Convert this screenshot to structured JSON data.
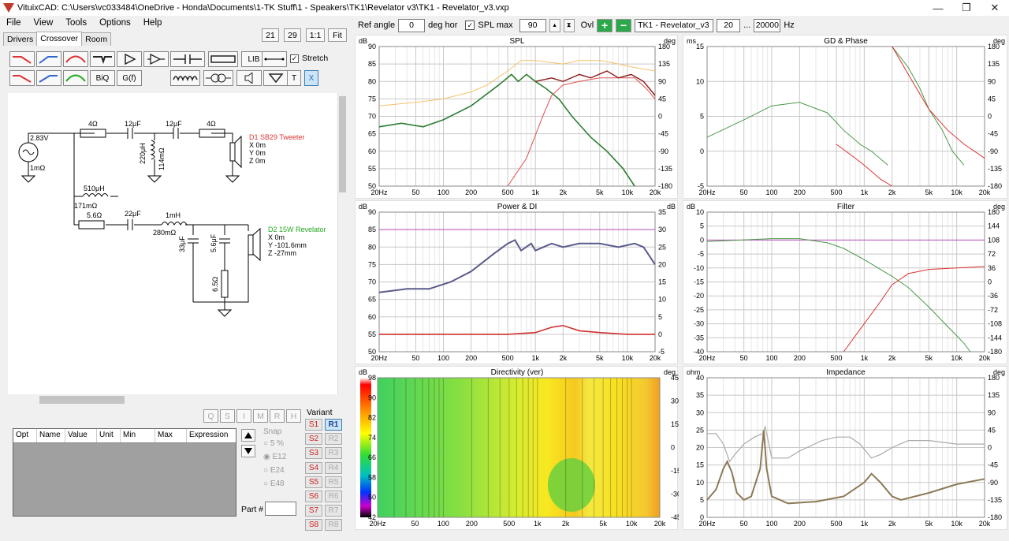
{
  "window": {
    "title": "VituixCAD: C:\\Users\\vc033484\\OneDrive - Honda\\Documents\\1-TK Stuff\\1 - Speakers\\TK1\\Revelator v3\\TK1 - Revelator_v3.vxp",
    "min": "—",
    "max": "❐",
    "close": "✕"
  },
  "menu": [
    "File",
    "View",
    "Tools",
    "Options",
    "Help"
  ],
  "tabs": [
    "Drivers",
    "Crossover",
    "Room"
  ],
  "zoom_buttons": [
    "21",
    "29",
    "1:1",
    "Fit"
  ],
  "toolbar": {
    "lib": "LIB",
    "biq": "BiQ",
    "gf": "G(f)",
    "stretch": "Stretch",
    "t": "T",
    "x": "X"
  },
  "top": {
    "ref_angle_label": "Ref angle",
    "ref_angle": "0",
    "deg_hor": "deg hor",
    "spl_max_label": "SPL max",
    "spl_max": "90",
    "ovl": "Ovl",
    "variant_name": "TK1 - Revelator_v3",
    "f_lo": "20",
    "dots": "...",
    "f_hi": "20000",
    "hz": "Hz"
  },
  "schematic": {
    "source": "2.83V",
    "source_r": "1mΩ",
    "r1": "4Ω",
    "c1": "12μF",
    "c2": "12μF",
    "r2": "4Ω",
    "l1": "220μH",
    "l1r": "114mΩ",
    "d1_name": "D1 SB29 Tweeter",
    "d1_x": "X 0m",
    "d1_y": "Y 0m",
    "d1_z": "Z 0m",
    "l2": "510μH",
    "l2r": "171mΩ",
    "r3": "5.6Ω",
    "c3": "22μF",
    "l3": "1mH",
    "l3r": "280mΩ",
    "c4": "33μF",
    "c5": "5.6μF",
    "r4": "6.5Ω",
    "d2_name": "D2 15W Revelator",
    "d2_x": "X 0m",
    "d2_y": "Y -101.6mm",
    "d2_z": "Z -27mm"
  },
  "param_buttons": [
    "Q",
    "S",
    "I",
    "M",
    "R",
    "H"
  ],
  "table_headers": [
    "Opt",
    "Name",
    "Value",
    "Unit",
    "Min",
    "Max",
    "Expression"
  ],
  "snap": {
    "label": "Snap",
    "options": [
      "5 %",
      "E12",
      "E24",
      "E48"
    ]
  },
  "part_label": "Part #",
  "variant": {
    "label": "Variant",
    "s": [
      "S1",
      "S2",
      "S3",
      "S4",
      "S5",
      "S6",
      "S7",
      "S8"
    ],
    "r": [
      "R1",
      "R2",
      "R3",
      "R4",
      "R5",
      "R6",
      "R7",
      "R8"
    ]
  },
  "charts": {
    "spl": {
      "title": "SPL",
      "lu": "dB",
      "ru": "deg",
      "left": [
        "90",
        "85",
        "80",
        "75",
        "70",
        "65",
        "60",
        "55",
        "50"
      ],
      "right": [
        "180",
        "135",
        "90",
        "45",
        "0",
        "-45",
        "-90",
        "-135",
        "-180"
      ],
      "x": [
        "20Hz",
        "50",
        "100",
        "200",
        "500",
        "1k",
        "2k",
        "5k",
        "10k",
        "20k"
      ]
    },
    "gd": {
      "title": "GD & Phase",
      "lu": "ms",
      "ru": "deg",
      "left": [
        "15",
        "10",
        "5",
        "0",
        "-5"
      ],
      "right": [
        "180",
        "135",
        "90",
        "45",
        "0",
        "-45",
        "-90",
        "-135",
        "-180"
      ],
      "x": [
        "20Hz",
        "50",
        "100",
        "200",
        "500",
        "1k",
        "2k",
        "5k",
        "10k",
        "20k"
      ]
    },
    "power": {
      "title": "Power & DI",
      "lu": "dB",
      "ru": "dB",
      "left": [
        "90",
        "85",
        "80",
        "75",
        "70",
        "65",
        "60",
        "55",
        "50"
      ],
      "right": [
        "35",
        "30",
        "25",
        "20",
        "15",
        "10",
        "5",
        "0",
        "-5"
      ],
      "x": [
        "20Hz",
        "50",
        "100",
        "200",
        "500",
        "1k",
        "2k",
        "5k",
        "10k",
        "20k"
      ]
    },
    "filter": {
      "title": "Filter",
      "lu": "dB",
      "ru": "deg",
      "left": [
        "10",
        "5",
        "0",
        "-5",
        "-10",
        "-15",
        "-20",
        "-25",
        "-30",
        "-35",
        "-40"
      ],
      "right": [
        "180",
        "144",
        "108",
        "72",
        "36",
        "0",
        "-36",
        "-72",
        "-108",
        "-144",
        "-180"
      ],
      "x": [
        "20Hz",
        "50",
        "100",
        "200",
        "500",
        "1k",
        "2k",
        "5k",
        "10k",
        "20k"
      ]
    },
    "dir": {
      "title": "Directivity (ver)",
      "lu": "dB",
      "ru": "deg",
      "scale": [
        "98",
        "90",
        "82",
        "74",
        "66",
        "58",
        "50",
        "42"
      ],
      "right": [
        "45",
        "30",
        "15",
        "0",
        "-15",
        "-30",
        "-45"
      ],
      "x": [
        "20Hz",
        "50",
        "100",
        "200",
        "500",
        "1k",
        "2k",
        "5k",
        "10k",
        "20k"
      ]
    },
    "imp": {
      "title": "Impedance",
      "lu": "ohm",
      "ru": "deg",
      "left": [
        "40",
        "35",
        "30",
        "25",
        "20",
        "15",
        "10",
        "5",
        "0"
      ],
      "right": [
        "180",
        "135",
        "90",
        "45",
        "0",
        "-45",
        "-90",
        "-135",
        "-180"
      ],
      "x": [
        "20Hz",
        "50",
        "100",
        "200",
        "500",
        "1k",
        "2k",
        "5k",
        "10k",
        "20k"
      ]
    }
  },
  "colors": {
    "bg": "#f0f0f0",
    "tweeter": "#e05050",
    "woofer": "#2e7d32",
    "sum": "#8b1a1a",
    "spl_axis": "#f6c26b",
    "power": "#5a5a8c",
    "di": "#d03030",
    "ref": "#c050c0"
  }
}
